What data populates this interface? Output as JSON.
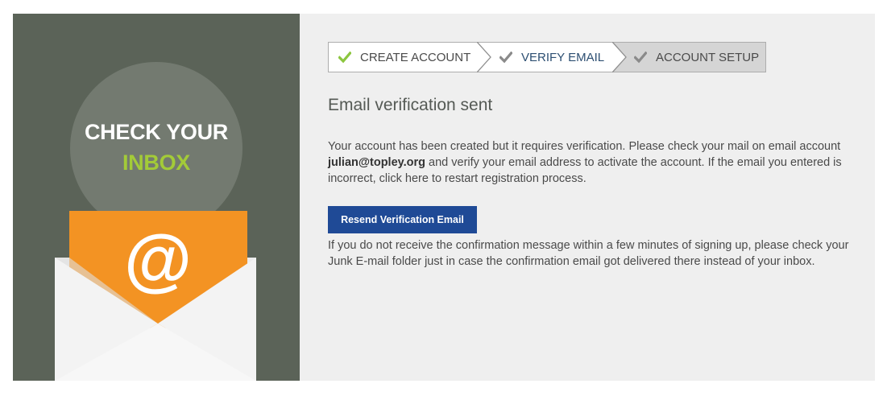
{
  "promo": {
    "headline_line1": "CHECK YOUR",
    "headline_line2": "INBOX",
    "symbol": "@"
  },
  "steps": [
    {
      "label": "CREATE ACCOUNT",
      "state": "completed",
      "check_color": "#8cc63f"
    },
    {
      "label": "VERIFY EMAIL",
      "state": "current",
      "check_color": "#8a8a8a"
    },
    {
      "label": "ACCOUNT SETUP",
      "state": "upcoming",
      "check_color": "#8a8a8a"
    }
  ],
  "main": {
    "title": "Email verification sent",
    "para_before_email": "Your account has been created but it requires verification. Please check your mail on email account ",
    "email": "julian@topley.org",
    "para_after_email": " and verify your email address to activate the account. If the email you entered is incorrect, click here to restart registration process.",
    "resend_button": "Resend Verification Email",
    "note": "If you do not receive the confirmation message within a few minutes of signing up, please check your Junk E-mail folder just in case the confirmation email got delivered there instead of your inbox."
  },
  "colors": {
    "panel": "#5b6358",
    "accent_green": "#a3cb38",
    "envelope_orange": "#f39323",
    "button_blue": "#1f4a96"
  }
}
